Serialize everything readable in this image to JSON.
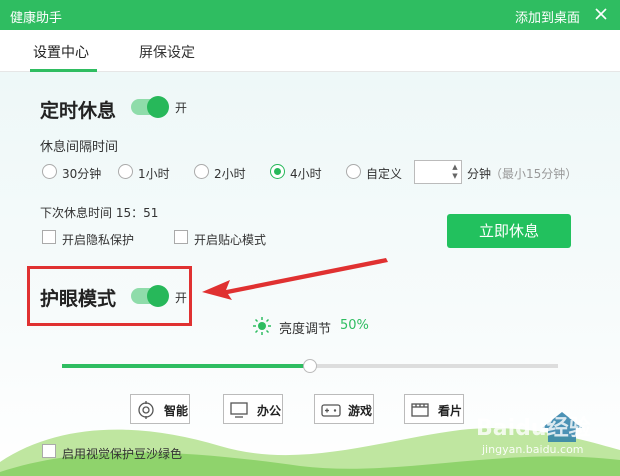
{
  "window": {
    "title": "健康助手",
    "pin_label": "添加到桌面"
  },
  "tabs": [
    {
      "label": "设置中心",
      "active": true
    },
    {
      "label": "屏保设定",
      "active": false
    }
  ],
  "rest": {
    "title": "定时休息",
    "toggle_on": true,
    "toggle_label": "开",
    "interval_label": "休息间隔时间",
    "options": [
      {
        "label": "30分钟",
        "checked": false
      },
      {
        "label": "1小时",
        "checked": false
      },
      {
        "label": "2小时",
        "checked": false
      },
      {
        "label": "4小时",
        "checked": true
      },
      {
        "label": "自定义",
        "checked": false
      }
    ],
    "custom_value": "",
    "custom_unit": "分钟",
    "custom_hint": "（最小15分钟）",
    "next_rest": "下次休息时间 15：51",
    "privacy_label": "开启隐私保护",
    "caring_label": "开启贴心模式",
    "rest_now": "立即休息"
  },
  "eye": {
    "title": "护眼模式",
    "toggle_on": true,
    "toggle_label": "开",
    "brightness_label": "亮度调节",
    "brightness_value": "50%",
    "brightness": 0.5,
    "modes": [
      {
        "label": "智能",
        "icon": "smart-icon"
      },
      {
        "label": "办公",
        "icon": "monitor-icon"
      },
      {
        "label": "游戏",
        "icon": "gamepad-icon"
      },
      {
        "label": "看片",
        "icon": "film-icon"
      }
    ],
    "green_bean_label": "启用视觉保护豆沙绿色"
  },
  "watermark": {
    "brand": "Baidu经验",
    "url": "jingyan.baidu.com"
  },
  "colors": {
    "brand": "#2fbd61",
    "button": "#22c15e",
    "annotation": "#e03131"
  }
}
